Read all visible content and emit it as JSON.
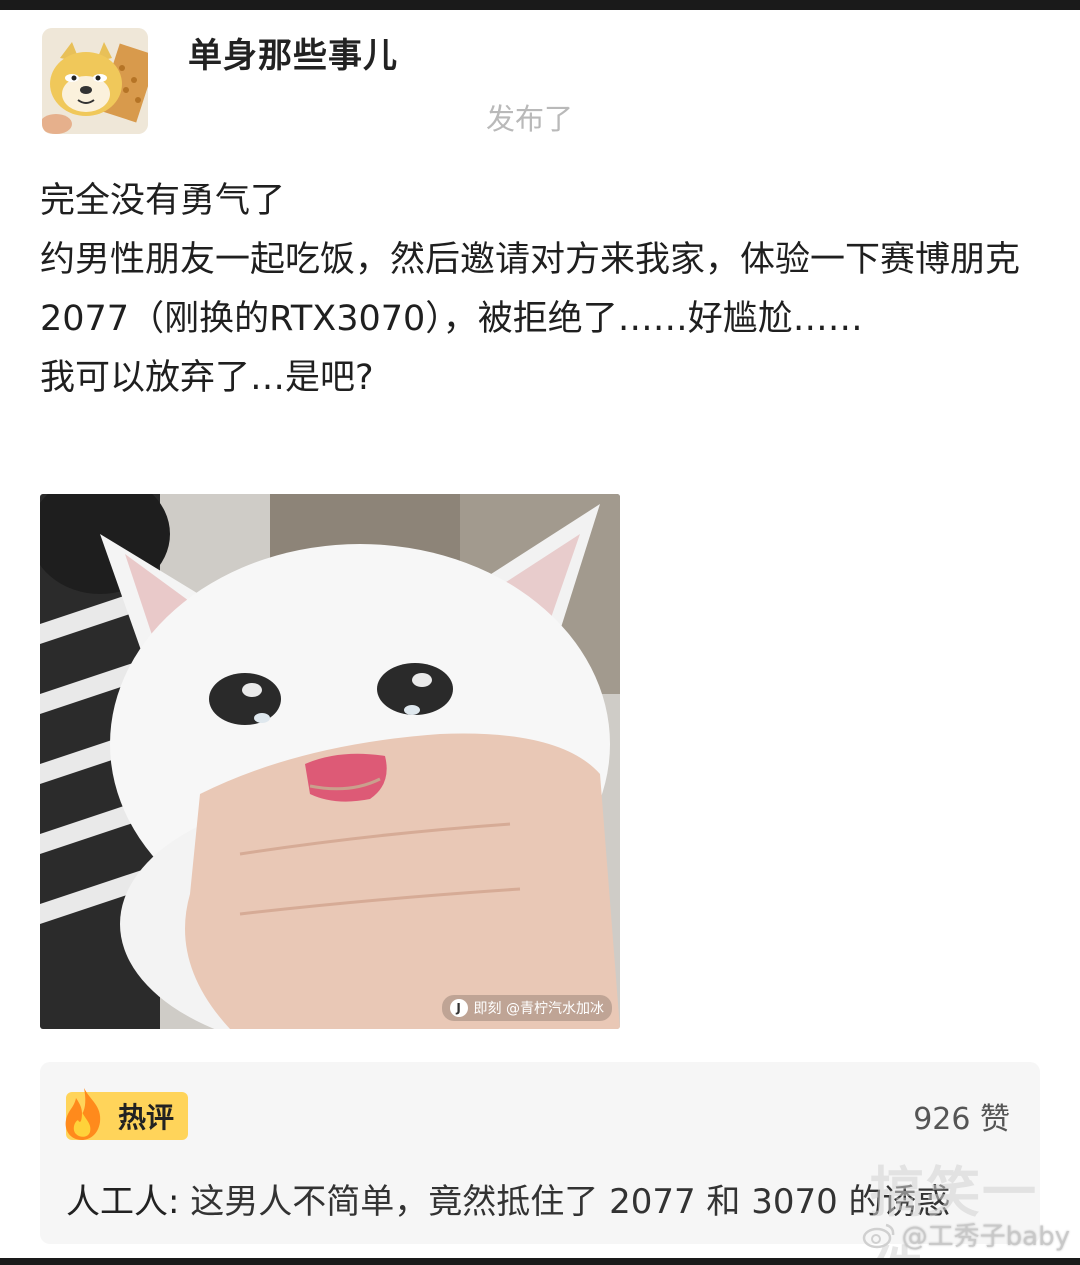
{
  "post": {
    "author": "单身那些事儿",
    "publish_label": "发布了",
    "lines": [
      "完全没有勇气了",
      "约男性朋友一起吃饭，然后邀请对方来我家，体验一下赛博朋克 2077（刚换的RTX3070），被拒绝了……好尴尬……",
      "我可以放弃了…是吧?"
    ],
    "image_watermark": "即刻 @青柠汽水加冰",
    "image_watermark_logo": "J"
  },
  "hot_comment": {
    "badge_label": "热评",
    "likes": "926 赞",
    "user": "人工人:",
    "text": " 这男人不简单，竟然抵住了 2077 和 3070 的诱惑"
  },
  "watermarks": {
    "corner": "@工秀子baby",
    "faint": "搞笑一件"
  },
  "icons": {
    "avatar": "doge-cookie-avatar",
    "hot_badge": "fire-icon",
    "corner": "weibo-icon"
  }
}
